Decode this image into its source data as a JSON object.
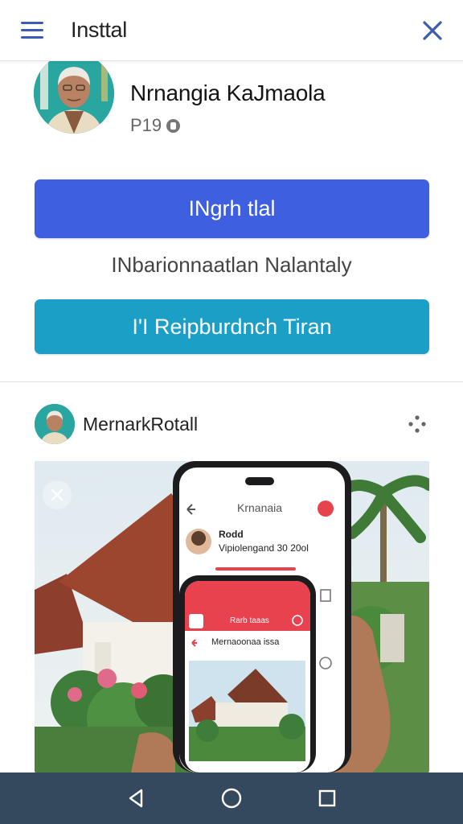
{
  "topbar": {
    "title": "Insttal",
    "menu_icon": "hamburger-menu-icon",
    "close_icon": "close-icon"
  },
  "profile": {
    "name": "Nrnangia KaJmaola",
    "meta": "P19",
    "meta_icon": "info-icon"
  },
  "actions": {
    "primary_label": "INgrh tlal",
    "subtitle": "INbarionnaatlan Nalantaly",
    "secondary_label": "I'I Reipburdnch Tiran"
  },
  "post": {
    "author": "MernarkRotall",
    "more_icon": "more-options-icon",
    "dismiss_icon": "close-circle-icon",
    "phone_back": {
      "header_title": "Krnanaia",
      "item_title": "Rodd",
      "item_subtitle": "Vipiolengand 30 20ol"
    },
    "phone_front": {
      "header_title": "Rarb taaas",
      "row_title": "Mernaoonaa issa"
    }
  },
  "navbar": {
    "back_icon": "back-triangle-icon",
    "home_icon": "home-circle-icon",
    "recents_icon": "recents-square-icon"
  },
  "colors": {
    "primary_button": "#3d5fe0",
    "secondary_button": "#1b9fc7",
    "accent": "#3b5bb5",
    "nav_bar": "#34495e",
    "phone_header_red": "#e8424f"
  }
}
